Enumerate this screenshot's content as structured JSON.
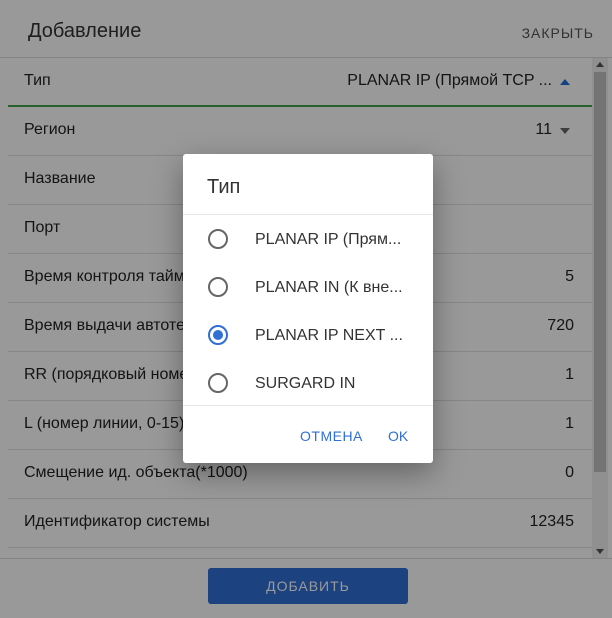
{
  "header": {
    "title": "Добавление",
    "close_label": "ЗАКРЫТЬ"
  },
  "form": {
    "rows": [
      {
        "label": "Тип",
        "value": "PLANAR IP (Прямой TCP ..."
      },
      {
        "label": "Регион",
        "value": "11"
      },
      {
        "label": "Название",
        "value": ""
      },
      {
        "label": "Порт",
        "value": ""
      },
      {
        "label": "Время контроля тайм",
        "value": "5"
      },
      {
        "label": "Время выдачи автоте",
        "value": "720"
      },
      {
        "label": "RR (порядковый номе",
        "value": "1"
      },
      {
        "label": "L (номер линии, 0-15)",
        "value": "1"
      },
      {
        "label": "Смещение ид. объекта(*1000)",
        "value": "0"
      },
      {
        "label": "Идентификатор системы",
        "value": "12345"
      }
    ]
  },
  "footer": {
    "add_label": "ДОБАВИТЬ"
  },
  "dialog": {
    "title": "Тип",
    "options": [
      {
        "label": "PLANAR IP (Прям...",
        "selected": false
      },
      {
        "label": "PLANAR IN (К вне...",
        "selected": false
      },
      {
        "label": "PLANAR IP NEXT ...",
        "selected": true
      },
      {
        "label": "SURGARD IN",
        "selected": false
      }
    ],
    "cancel_label": "ОТМЕНА",
    "ok_label": "OK"
  },
  "colors": {
    "accent": "#2f6fd6",
    "active_underline": "#43a047"
  }
}
